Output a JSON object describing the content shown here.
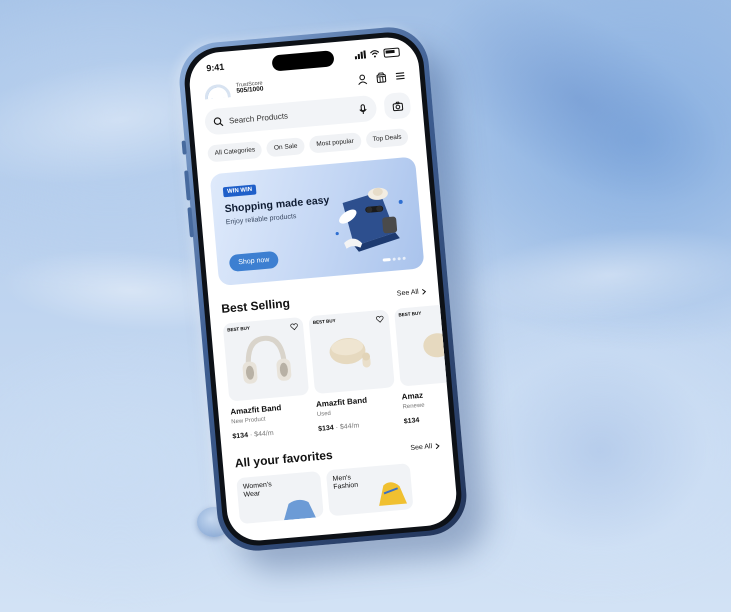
{
  "status_bar": {
    "time": "9:41"
  },
  "trust_score": {
    "label": "TrustScore",
    "value": "505/1000",
    "fraction": 0.505
  },
  "icons": {
    "profile": "user-icon",
    "store": "store-icon",
    "menu": "menu-icon",
    "search": "search-icon",
    "mic": "mic-icon",
    "camera": "camera-icon"
  },
  "search": {
    "placeholder": "Search Products"
  },
  "categories": [
    "All Categories",
    "On Sale",
    "Most popular",
    "Top Deals"
  ],
  "banner": {
    "badge": "WIN WIN",
    "title": "Shopping made easy",
    "subtitle": "Enjoy reliable products",
    "cta": "Shop now"
  },
  "best_selling": {
    "title": "Best Selling",
    "see_all": "See All",
    "products": [
      {
        "brand": "BEST BUY",
        "name": "Amazfit Band",
        "condition": "New Product",
        "price": "$134",
        "monthly": "$44/m"
      },
      {
        "brand": "BEST BUY",
        "name": "Amazfit Band",
        "condition": "Used",
        "price": "$134",
        "monthly": "$44/m"
      },
      {
        "brand": "BEST BUY",
        "name": "Amaz",
        "condition": "Renewe",
        "price": "$134",
        "monthly": ""
      }
    ]
  },
  "favorites": {
    "title": "All your favorites",
    "see_all": "See All",
    "items": [
      {
        "label": "Women's Wear"
      },
      {
        "label": "Men's Fashion"
      }
    ]
  },
  "colors": {
    "accent": "#3d7fd1",
    "badge": "#1f5fc9",
    "best_buy_yellow": "#ffe000"
  }
}
